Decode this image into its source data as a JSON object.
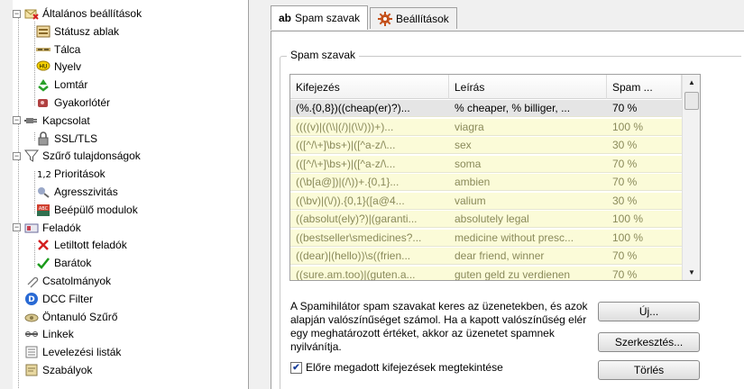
{
  "tree": [
    {
      "id": "altalanos",
      "label": "Általános beállítások",
      "icon": "mail-x-icon",
      "expander": "−",
      "level": 0
    },
    {
      "id": "statusz",
      "label": "Státusz ablak",
      "icon": "window-icon",
      "level": 1
    },
    {
      "id": "talca",
      "label": "Tálca",
      "icon": "taskbar-icon",
      "level": 1
    },
    {
      "id": "nyelv",
      "label": "Nyelv",
      "icon": "language-bubble-icon",
      "level": 1
    },
    {
      "id": "lomtar",
      "label": "Lomtár",
      "icon": "recycle-icon",
      "level": 1
    },
    {
      "id": "gyakorlo",
      "label": "Gyakorlótér",
      "icon": "training-icon",
      "level": 1
    },
    {
      "id": "kapcsolat",
      "label": "Kapcsolat",
      "icon": "plug-icon",
      "expander": "−",
      "level": 0
    },
    {
      "id": "ssl",
      "label": "SSL/TLS",
      "icon": "lock-icon",
      "level": 1
    },
    {
      "id": "szuro",
      "label": "Szűrő tulajdonságok",
      "icon": "filter-funnel-icon",
      "expander": "−",
      "level": 0
    },
    {
      "id": "prioritasok",
      "label": "Prioritások",
      "icon": "priority-12-icon",
      "level": 1
    },
    {
      "id": "agresszivitas",
      "label": "Agresszivitás",
      "icon": "aggressiveness-icon",
      "level": 1
    },
    {
      "id": "beepulo",
      "label": "Beépülő modulok",
      "icon": "plugin-modules-icon",
      "level": 1
    },
    {
      "id": "feladok",
      "label": "Feladók",
      "icon": "senders-icon",
      "expander": "−",
      "level": 0
    },
    {
      "id": "letiltott",
      "label": "Letiltott feladók",
      "icon": "red-x-icon",
      "level": 1
    },
    {
      "id": "baratok",
      "label": "Barátok",
      "icon": "green-check-icon",
      "level": 1
    },
    {
      "id": "csatolmanyok",
      "label": "Csatolmányok",
      "icon": "paperclip-icon",
      "level": 0
    },
    {
      "id": "dcc",
      "label": "DCC Filter",
      "icon": "dcc-filter-icon",
      "level": 0
    },
    {
      "id": "ontanulo",
      "label": "Öntanuló Szűrő",
      "icon": "self-learning-filter-icon",
      "level": 0
    },
    {
      "id": "linkek",
      "label": "Linkek",
      "icon": "links-icon",
      "level": 0
    },
    {
      "id": "levelezesi",
      "label": "Levelezési listák",
      "icon": "mailing-list-icon",
      "level": 0
    },
    {
      "id": "szabalyok",
      "label": "Szabályok",
      "icon": "rules-icon",
      "level": 0
    }
  ],
  "tabs": [
    {
      "label": "Spam szavak",
      "prefix": "ab",
      "active": true
    },
    {
      "label": "Beállítások",
      "prefix": "",
      "icon": "gear-icon",
      "active": false
    }
  ],
  "group_title": "Spam szavak",
  "grid": {
    "columns": [
      "Kifejezés",
      "Leírás",
      "Spam ..."
    ],
    "rows": [
      {
        "expr": "(%.{0,8})((cheap(er)?)...",
        "desc": "% cheaper, % billiger, ...",
        "spam": "70 %",
        "state": "selected"
      },
      {
        "expr": "((((v)|((\\\\|(/)|(\\\\/)))+)...",
        "desc": "viagra",
        "spam": "100 %",
        "state": "highlight"
      },
      {
        "expr": "(([^/\\+]\\bs+)|([^a-z/\\...",
        "desc": "sex",
        "spam": "30 %",
        "state": "highlight"
      },
      {
        "expr": "(([^/\\+]\\bs+)|([^a-z/\\...",
        "desc": "soma",
        "spam": "70 %",
        "state": "highlight"
      },
      {
        "expr": "((\\b[a@])|(/\\))+.{0,1}...",
        "desc": "ambien",
        "spam": "70 %",
        "state": "highlight"
      },
      {
        "expr": "((\\bv)|(\\/)).{0,1}([a@4...",
        "desc": "valium",
        "spam": "30 %",
        "state": "highlight"
      },
      {
        "expr": "((absolut(ely)?)|(garanti...",
        "desc": "absolutely legal",
        "spam": "100 %",
        "state": "highlight"
      },
      {
        "expr": "((bestseller\\smedicines?...",
        "desc": "medicine without presc...",
        "spam": "100 %",
        "state": "highlight"
      },
      {
        "expr": "((dear)|(hello))\\s((frien...",
        "desc": "dear friend, winner",
        "spam": "70 %",
        "state": "highlight"
      },
      {
        "expr": "((sure.am.too)|(guten.a...",
        "desc": "guten geld zu verdienen",
        "spam": "70 %",
        "state": "highlight"
      }
    ]
  },
  "description": "A Spamihilátor spam szavakat keres az üzenetekben, és azok alapján valószínűséget számol. Ha a kapott valószínűség elér egy meghatározott értéket, akkor az üzenetet spamnek nyilvánítja.",
  "buttons": {
    "new": "Új...",
    "edit": "Szerkesztés...",
    "delete": "Törlés"
  },
  "checkbox": {
    "label": "Előre megadott kifejezések megtekintése",
    "checked": true
  },
  "colors": {
    "selected_row": "#e5e5e5",
    "highlight_row": "#fbfbd8",
    "highlight_text": "#8a8a5a"
  }
}
